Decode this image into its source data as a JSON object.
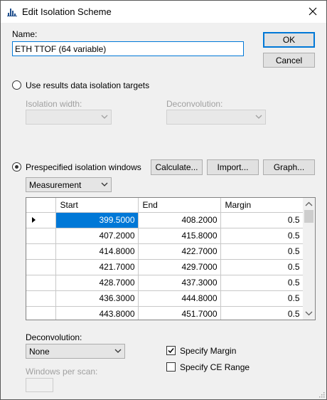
{
  "window": {
    "title": "Edit Isolation Scheme"
  },
  "name_label": "Name:",
  "name_value": "ETH TTOF (64 variable)",
  "buttons": {
    "ok": "OK",
    "cancel": "Cancel",
    "calculate": "Calculate...",
    "import": "Import...",
    "graph": "Graph..."
  },
  "radio_results": {
    "label": "Use results data isolation targets",
    "checked": false
  },
  "isolation_width_label": "Isolation width:",
  "deconvolution_top_label": "Deconvolution:",
  "radio_prespecified": {
    "label": "Prespecified isolation windows",
    "checked": true
  },
  "windows_type_select": "Measurement",
  "grid": {
    "columns": [
      "Start",
      "End",
      "Margin"
    ],
    "rows": [
      [
        "399.5000",
        "408.2000",
        "0.5"
      ],
      [
        "407.2000",
        "415.8000",
        "0.5"
      ],
      [
        "414.8000",
        "422.7000",
        "0.5"
      ],
      [
        "421.7000",
        "429.7000",
        "0.5"
      ],
      [
        "428.7000",
        "437.3000",
        "0.5"
      ],
      [
        "436.3000",
        "444.8000",
        "0.5"
      ],
      [
        "443.8000",
        "451.7000",
        "0.5"
      ]
    ]
  },
  "deconvolution_label": "Deconvolution:",
  "deconvolution_value": "None",
  "specify_margin": {
    "label": "Specify Margin",
    "checked": true
  },
  "specify_ce_range": {
    "label": "Specify CE Range",
    "checked": false
  },
  "windows_per_scan_label": "Windows per scan:",
  "colors": {
    "accent": "#0078d7",
    "disabled_text": "#a0a0a0"
  }
}
